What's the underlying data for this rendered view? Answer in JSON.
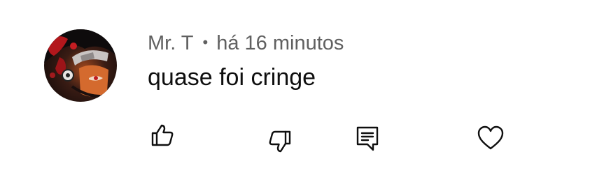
{
  "comment": {
    "author": "Mr. T",
    "separator": "•",
    "time": "há 16 minutos",
    "text": "quase foi cringe"
  },
  "icons": {
    "avatar": "avatar-image",
    "like": "thumbs-up-icon",
    "dislike": "thumbs-down-icon",
    "reply": "reply-comment-icon",
    "heart": "heart-icon"
  },
  "colors": {
    "meta_text": "#606060",
    "body_text": "#0f0f0f",
    "icon_stroke": "#0f0f0f"
  }
}
